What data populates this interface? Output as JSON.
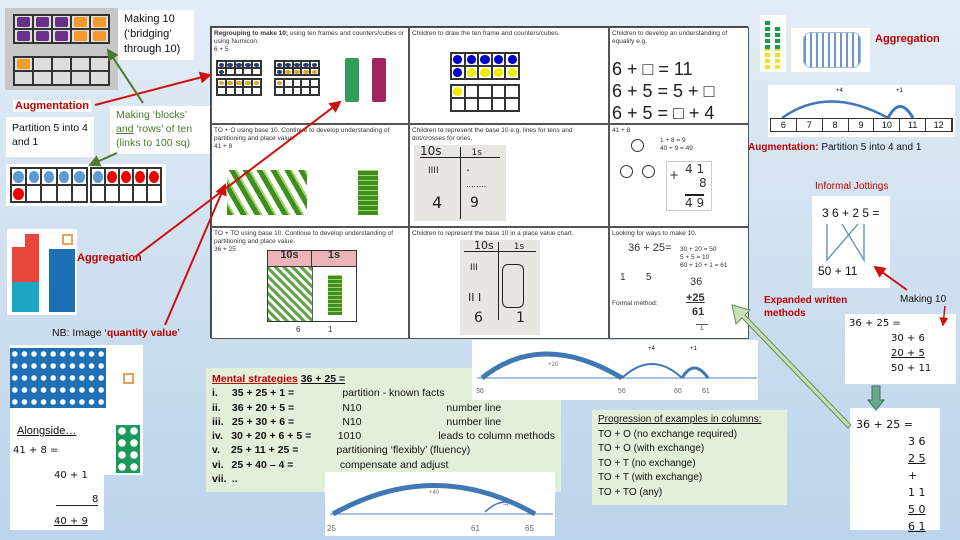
{
  "top_left": {
    "bridging_label": "Making 10 (‘bridging’ through 10)",
    "augmentation": "Augmentation",
    "partition": "Partition 5 into 4 and 1",
    "blocks_rows": "Making ‘blocks’",
    "blocks_and": "and",
    "blocks_rest": " ‘rows’ of ten",
    "blocks_links": "(links to 100 sq)"
  },
  "table": {
    "r1c1": {
      "title": "Regrouping to make 10;",
      "text": " using ten frames and counters/cubes or using Numicon.",
      "sum": "6 + 5"
    },
    "r1c2": {
      "text": "Children to draw the ten frame and counters/cubes."
    },
    "r1c3": {
      "text": "Children to develop an understanding of equality e.g.",
      "eqs": [
        "6 + □ = 11",
        "6 + 5 = 5 + □",
        "6 + 5 = □ + 4"
      ]
    },
    "r2c1": {
      "text": "TO + O using base 10. Continue to develop understanding of partitioning and place value.",
      "sum": "41 + 8"
    },
    "r2c2": {
      "text": "Children to represent the base 10 e.g. lines for tens and dot/crosses for ones.",
      "tens": "10s",
      "ones": "1s",
      "tally": "IIII",
      "dot": ".",
      "dots": "........",
      "t_res": "4",
      "o_res": "9"
    },
    "r2c3": {
      "sum": "41 + 8",
      "f1": "1 + 8 = 9",
      "f2": "40 + 9 = 49",
      "c1": "4 1",
      "c2": "8",
      "c3": "4 9",
      "plus": "+"
    },
    "r3c1": {
      "text": "TO + TO using base 10. Continue to develop understanding of partitioning and place value.",
      "sum": "36 + 25",
      "tens": "10s",
      "ones": "1s",
      "t_res": "6",
      "o_res": "1"
    },
    "r3c2": {
      "text": "Children to represent the base 10 in a place value chart.",
      "tens": "10s",
      "ones": "1s",
      "t1": "III",
      "t2": "II  I",
      "t_res": "6",
      "o_res": "1"
    },
    "r3c3": {
      "text": "Looking for ways to make 10.",
      "sum": "36 + 25=",
      "p1": "1",
      "p2": "5",
      "f1": "30 + 20 = 50",
      "f2": "5 + 5 = 10",
      "f3": "60 + 10 + 1 = 61",
      "formal": "Formal method:",
      "a": "36",
      "b": "+25",
      "c": "61",
      "carry": "1"
    }
  },
  "right": {
    "aggregation": "Aggregation",
    "numberline": [
      "6",
      "7",
      "8",
      "9",
      "10",
      "11",
      "12"
    ],
    "jump1": "+4",
    "jump2": "+1",
    "augmentation": "Augmentation:",
    "augmentation_text": "Partition 5 into 4 and 1",
    "informal": "Informal Jottings",
    "jot_top": "3 6 + 2 5 =",
    "jot_bottom": "50  +  11",
    "expanded": "Expanded written methods",
    "making10": "Making 10",
    "exp": [
      "36 + 25 =",
      "30  +  6",
      "20  +  5",
      "50  +  11"
    ],
    "col": [
      "36 + 25 =",
      "3 6",
      "2 5",
      "+",
      "1 1",
      "5 0",
      "6 1"
    ]
  },
  "left": {
    "aggregation": "Aggregation",
    "nb": "NB: Image ‘",
    "nb_red": "quantity value",
    "nb_end": "’",
    "alongside": "Alongside…",
    "a1": "41 + 8 =",
    "a2": "40  +  1",
    "a3": "8",
    "a4": "40  +  9"
  },
  "mental": {
    "title": "Mental strategies",
    "title_sum": "36 + 25 =",
    "rows": [
      {
        "n": "i.",
        "e": "35 + 25 + 1 =",
        "m": "partition - known facts",
        "d": ""
      },
      {
        "n": "ii.",
        "e": "36 + 20 + 5 =",
        "m": "N10",
        "d": "number line"
      },
      {
        "n": "iii.",
        "e": "25 + 30 + 6 =",
        "m": "N10",
        "d": "number line"
      },
      {
        "n": "iv.",
        "e": "30 + 20 + 6 + 5 =",
        "m": "1010",
        "d": "leads to column methods"
      },
      {
        "n": "v.",
        "e": "25 + 11 + 25 =",
        "m": "partitioning ‘flexibly’ (fluency)",
        "d": ""
      },
      {
        "n": "vi.",
        "e": "25 + 40 – 4 =",
        "m": "compensate and adjust",
        "d": ""
      },
      {
        "n": "vii.",
        "e": "..",
        "m": "",
        "d": ""
      }
    ]
  },
  "nl_top": {
    "j1": "+20",
    "j2": "+4",
    "j3": "+1",
    "l1": "36",
    "l2": "56",
    "l3": "60",
    "l4": "61"
  },
  "nl_bottom": {
    "j1": "+40",
    "j2": "-4",
    "l1": "25",
    "l2": "61",
    "l3": "65"
  },
  "progression": {
    "title": "Progression of examples in columns:",
    "items": [
      "TO + O (no exchange required)",
      "TO + O (with exchange)",
      "TO + T (no exchange)",
      "TO + T (with exchange)",
      "TO + TO (any)"
    ]
  },
  "colors": {
    "red": "#c00000",
    "green_box": "#e2efd9",
    "arrow_red": "#d01010",
    "arrow_green": "#4a7a2a",
    "numicon_blue": "#1f6fb5"
  }
}
